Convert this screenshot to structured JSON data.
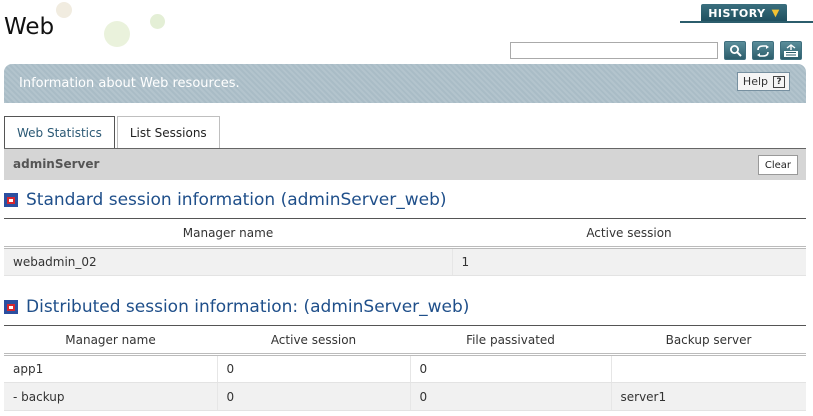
{
  "page": {
    "title": "Web",
    "history_label": "HISTORY",
    "search_placeholder": ""
  },
  "banner": {
    "text": "Information about Web resources.",
    "help_label": "Help"
  },
  "tabs": [
    {
      "label": "Web Statistics",
      "active": true
    },
    {
      "label": "List Sessions",
      "active": false
    }
  ],
  "server": {
    "name": "adminServer",
    "clear_label": "Clear"
  },
  "standard": {
    "title": "Standard session information (adminServer_web)",
    "headers": [
      "Manager name",
      "Active session"
    ],
    "rows": [
      [
        "webadmin_02",
        "1"
      ]
    ]
  },
  "distributed": {
    "title": "Distributed session information: (adminServer_web)",
    "headers": [
      "Manager name",
      "Active session",
      "File passivated",
      "Backup server"
    ],
    "rows": [
      [
        "app1",
        "0",
        "0",
        ""
      ],
      [
        "- backup",
        "0",
        "0",
        "server1"
      ]
    ]
  },
  "icons": {
    "history": "chevron-down-icon",
    "search": "search-icon",
    "refresh": "refresh-icon",
    "xml": "xml-export-icon",
    "help": "help-icon",
    "section": "section-bullet-icon"
  },
  "colors": {
    "accent": "#1f4f8a",
    "banner": "#a9bcc6",
    "history": "#2b5d6c"
  }
}
